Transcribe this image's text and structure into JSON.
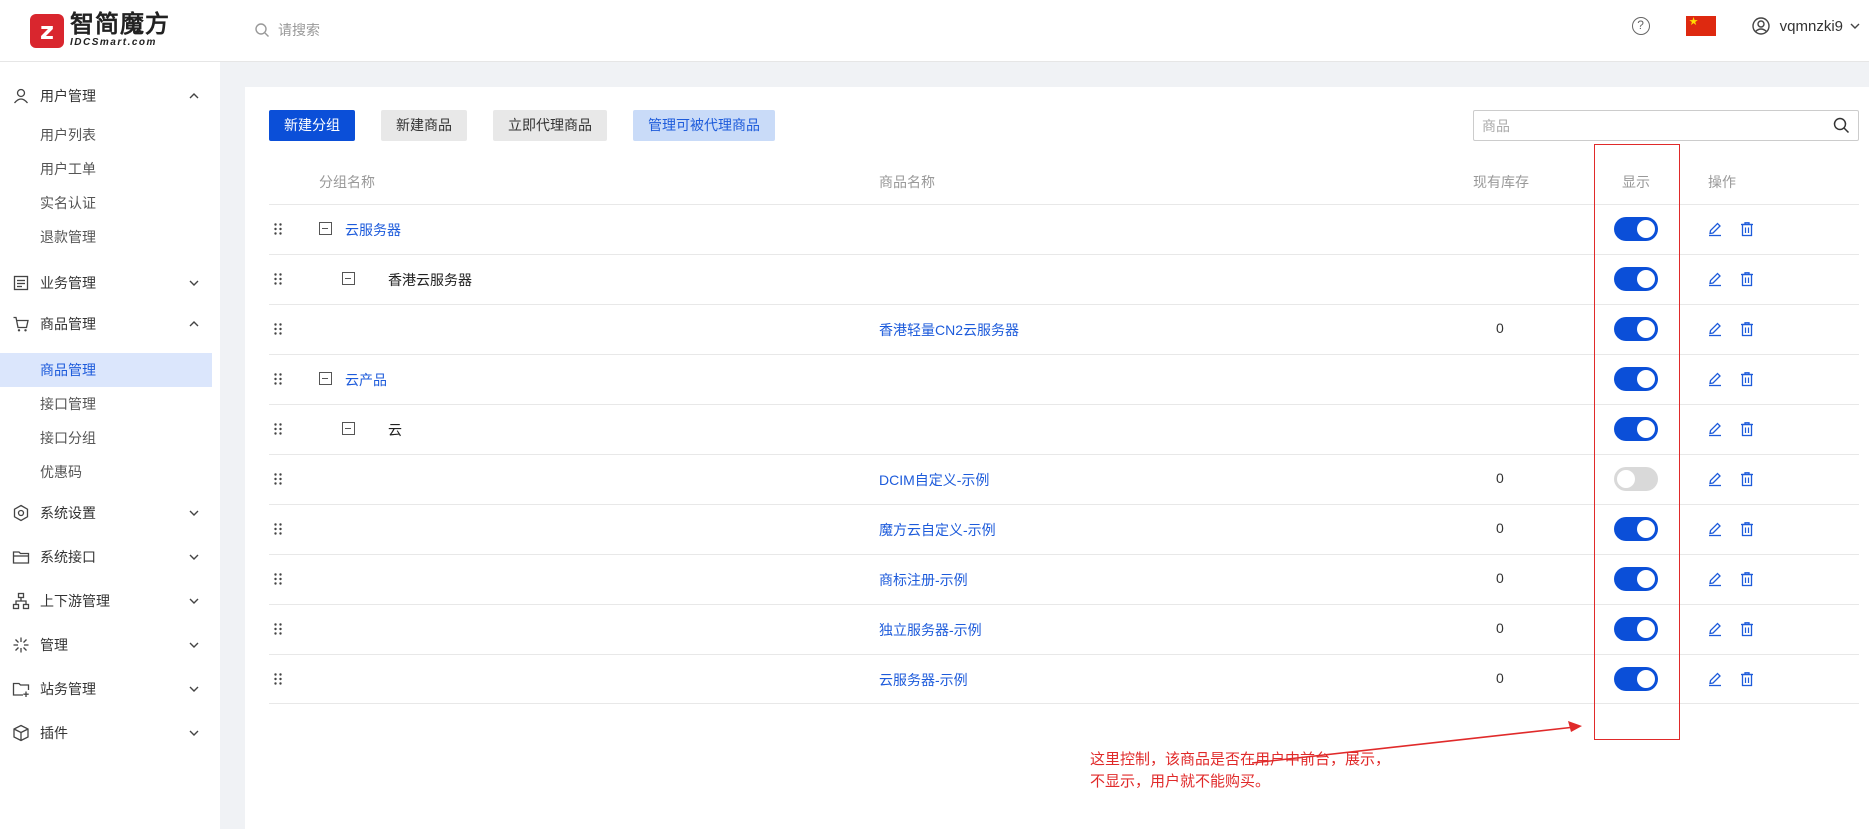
{
  "header": {
    "logo_mark": "z",
    "logo_cn": "智简魔方",
    "logo_en": "IDCSmart.com",
    "search_placeholder": "请搜索",
    "help": "?",
    "username": "vqmnzki9"
  },
  "sidebar": {
    "groups": [
      {
        "label": "用户管理",
        "icon": "user-icon",
        "expanded": true
      },
      {
        "label": "业务管理",
        "icon": "document-icon",
        "expanded": false
      },
      {
        "label": "商品管理",
        "icon": "cart-icon",
        "expanded": true
      },
      {
        "label": "系统设置",
        "icon": "hexagon-settings-icon",
        "expanded": false
      },
      {
        "label": "系统接口",
        "icon": "folder-icon",
        "expanded": false
      },
      {
        "label": "上下游管理",
        "icon": "hierarchy-icon",
        "expanded": false
      },
      {
        "label": "管理",
        "icon": "sparkle-icon",
        "expanded": false
      },
      {
        "label": "站务管理",
        "icon": "folder-add-icon",
        "expanded": false
      },
      {
        "label": "插件",
        "icon": "cube-icon",
        "expanded": false
      }
    ],
    "user_items": [
      "用户列表",
      "用户工单",
      "实名认证",
      "退款管理"
    ],
    "product_items": [
      "商品管理",
      "接口管理",
      "接口分组",
      "优惠码"
    ],
    "active_item": "商品管理"
  },
  "toolbar": {
    "new_group": "新建分组",
    "new_product": "新建商品",
    "agent_product": "立即代理商品",
    "manage_agent": "管理可被代理商品",
    "search_placeholder": "商品"
  },
  "table": {
    "headers": {
      "group": "分组名称",
      "product": "商品名称",
      "stock": "现有库存",
      "show": "显示",
      "action": "操作"
    },
    "rows": [
      {
        "group": "云服务器",
        "product": "",
        "stock": "",
        "show": true
      },
      {
        "group": "香港云服务器",
        "product": "",
        "stock": "",
        "show": true
      },
      {
        "group": "",
        "product": "香港轻量CN2云服务器",
        "stock": "0",
        "show": true
      },
      {
        "group": "云产品",
        "product": "",
        "stock": "",
        "show": true
      },
      {
        "group": "云",
        "product": "",
        "stock": "",
        "show": true
      },
      {
        "group": "",
        "product": "DCIM自定义-示例",
        "stock": "0",
        "show": false
      },
      {
        "group": "",
        "product": "魔方云自定义-示例",
        "stock": "0",
        "show": true
      },
      {
        "group": "",
        "product": "商标注册-示例",
        "stock": "0",
        "show": true
      },
      {
        "group": "",
        "product": "独立服务器-示例",
        "stock": "0",
        "show": true
      },
      {
        "group": "",
        "product": "云服务器-示例",
        "stock": "0",
        "show": true
      }
    ]
  },
  "annotation": {
    "line1": "这里控制，该商品是否在用户中前台，展示，",
    "line2": "不显示，用户就不能购买。",
    "color": "#e02a2a"
  }
}
